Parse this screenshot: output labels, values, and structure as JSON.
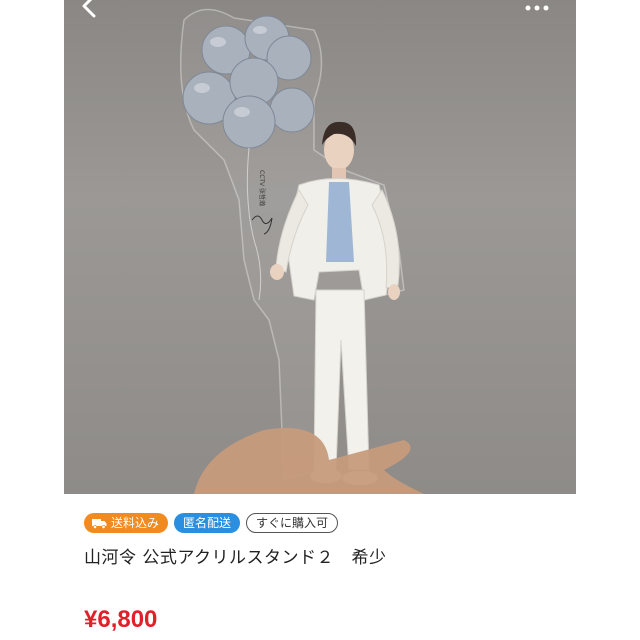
{
  "product": {
    "image_alt": "山河令 公式アクリルスタンド2",
    "badges": {
      "shipping_label": "送料込み",
      "anonymous_label": "匿名配送",
      "buy_now_label": "すぐに購入可"
    },
    "title": "山河令 公式アクリルスタンド２　希少",
    "price": "¥6,800"
  },
  "icons": {
    "back": "chevron-left-icon",
    "more": "more-dots-icon",
    "truck": "truck-icon"
  },
  "colors": {
    "shipping_badge": "#f28a1f",
    "anonymous_badge": "#2a8fe0",
    "price": "#e0202a"
  }
}
